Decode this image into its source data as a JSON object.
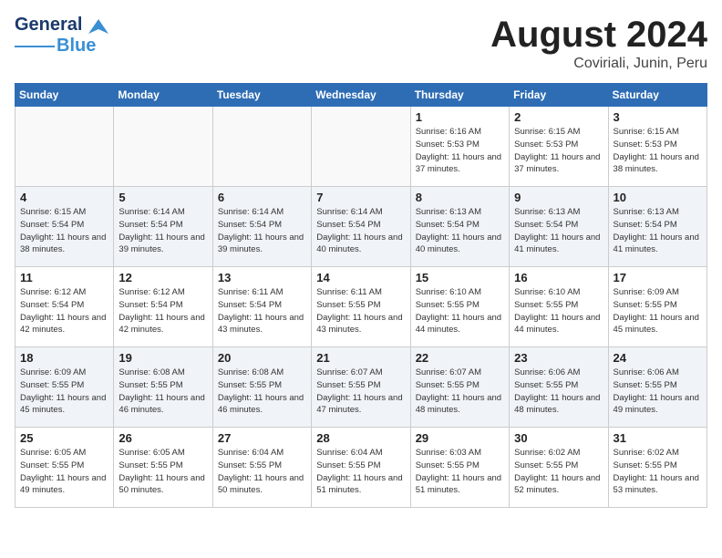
{
  "header": {
    "logo_general": "General",
    "logo_blue": "Blue",
    "month_year": "August 2024",
    "location": "Coviriali, Junin, Peru"
  },
  "days_of_week": [
    "Sunday",
    "Monday",
    "Tuesday",
    "Wednesday",
    "Thursday",
    "Friday",
    "Saturday"
  ],
  "weeks": [
    [
      {
        "day": "",
        "info": ""
      },
      {
        "day": "",
        "info": ""
      },
      {
        "day": "",
        "info": ""
      },
      {
        "day": "",
        "info": ""
      },
      {
        "day": "1",
        "info": "Sunrise: 6:16 AM\nSunset: 5:53 PM\nDaylight: 11 hours and 37 minutes."
      },
      {
        "day": "2",
        "info": "Sunrise: 6:15 AM\nSunset: 5:53 PM\nDaylight: 11 hours and 37 minutes."
      },
      {
        "day": "3",
        "info": "Sunrise: 6:15 AM\nSunset: 5:53 PM\nDaylight: 11 hours and 38 minutes."
      }
    ],
    [
      {
        "day": "4",
        "info": "Sunrise: 6:15 AM\nSunset: 5:54 PM\nDaylight: 11 hours and 38 minutes."
      },
      {
        "day": "5",
        "info": "Sunrise: 6:14 AM\nSunset: 5:54 PM\nDaylight: 11 hours and 39 minutes."
      },
      {
        "day": "6",
        "info": "Sunrise: 6:14 AM\nSunset: 5:54 PM\nDaylight: 11 hours and 39 minutes."
      },
      {
        "day": "7",
        "info": "Sunrise: 6:14 AM\nSunset: 5:54 PM\nDaylight: 11 hours and 40 minutes."
      },
      {
        "day": "8",
        "info": "Sunrise: 6:13 AM\nSunset: 5:54 PM\nDaylight: 11 hours and 40 minutes."
      },
      {
        "day": "9",
        "info": "Sunrise: 6:13 AM\nSunset: 5:54 PM\nDaylight: 11 hours and 41 minutes."
      },
      {
        "day": "10",
        "info": "Sunrise: 6:13 AM\nSunset: 5:54 PM\nDaylight: 11 hours and 41 minutes."
      }
    ],
    [
      {
        "day": "11",
        "info": "Sunrise: 6:12 AM\nSunset: 5:54 PM\nDaylight: 11 hours and 42 minutes."
      },
      {
        "day": "12",
        "info": "Sunrise: 6:12 AM\nSunset: 5:54 PM\nDaylight: 11 hours and 42 minutes."
      },
      {
        "day": "13",
        "info": "Sunrise: 6:11 AM\nSunset: 5:54 PM\nDaylight: 11 hours and 43 minutes."
      },
      {
        "day": "14",
        "info": "Sunrise: 6:11 AM\nSunset: 5:55 PM\nDaylight: 11 hours and 43 minutes."
      },
      {
        "day": "15",
        "info": "Sunrise: 6:10 AM\nSunset: 5:55 PM\nDaylight: 11 hours and 44 minutes."
      },
      {
        "day": "16",
        "info": "Sunrise: 6:10 AM\nSunset: 5:55 PM\nDaylight: 11 hours and 44 minutes."
      },
      {
        "day": "17",
        "info": "Sunrise: 6:09 AM\nSunset: 5:55 PM\nDaylight: 11 hours and 45 minutes."
      }
    ],
    [
      {
        "day": "18",
        "info": "Sunrise: 6:09 AM\nSunset: 5:55 PM\nDaylight: 11 hours and 45 minutes."
      },
      {
        "day": "19",
        "info": "Sunrise: 6:08 AM\nSunset: 5:55 PM\nDaylight: 11 hours and 46 minutes."
      },
      {
        "day": "20",
        "info": "Sunrise: 6:08 AM\nSunset: 5:55 PM\nDaylight: 11 hours and 46 minutes."
      },
      {
        "day": "21",
        "info": "Sunrise: 6:07 AM\nSunset: 5:55 PM\nDaylight: 11 hours and 47 minutes."
      },
      {
        "day": "22",
        "info": "Sunrise: 6:07 AM\nSunset: 5:55 PM\nDaylight: 11 hours and 48 minutes."
      },
      {
        "day": "23",
        "info": "Sunrise: 6:06 AM\nSunset: 5:55 PM\nDaylight: 11 hours and 48 minutes."
      },
      {
        "day": "24",
        "info": "Sunrise: 6:06 AM\nSunset: 5:55 PM\nDaylight: 11 hours and 49 minutes."
      }
    ],
    [
      {
        "day": "25",
        "info": "Sunrise: 6:05 AM\nSunset: 5:55 PM\nDaylight: 11 hours and 49 minutes."
      },
      {
        "day": "26",
        "info": "Sunrise: 6:05 AM\nSunset: 5:55 PM\nDaylight: 11 hours and 50 minutes."
      },
      {
        "day": "27",
        "info": "Sunrise: 6:04 AM\nSunset: 5:55 PM\nDaylight: 11 hours and 50 minutes."
      },
      {
        "day": "28",
        "info": "Sunrise: 6:04 AM\nSunset: 5:55 PM\nDaylight: 11 hours and 51 minutes."
      },
      {
        "day": "29",
        "info": "Sunrise: 6:03 AM\nSunset: 5:55 PM\nDaylight: 11 hours and 51 minutes."
      },
      {
        "day": "30",
        "info": "Sunrise: 6:02 AM\nSunset: 5:55 PM\nDaylight: 11 hours and 52 minutes."
      },
      {
        "day": "31",
        "info": "Sunrise: 6:02 AM\nSunset: 5:55 PM\nDaylight: 11 hours and 53 minutes."
      }
    ]
  ]
}
